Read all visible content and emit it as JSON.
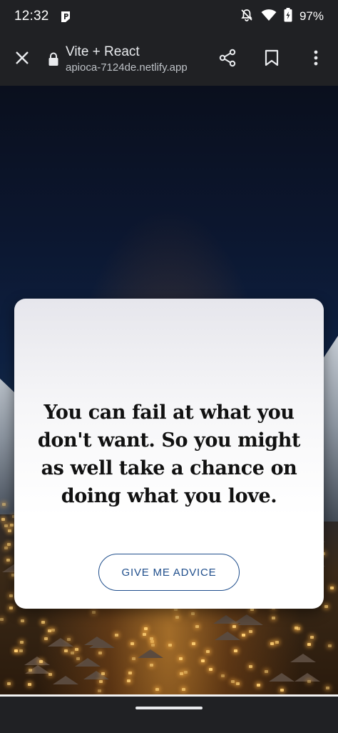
{
  "status_bar": {
    "time": "12:32",
    "battery": "97%",
    "icons": [
      "parking-p-icon",
      "bell-off-icon",
      "wifi-icon",
      "battery-charging-icon"
    ]
  },
  "browser": {
    "page_title": "Vite + React",
    "url": "apioca-7124de.netlify.app",
    "icons": [
      "close-icon",
      "lock-icon",
      "share-icon",
      "bookmark-icon",
      "more-vert-icon"
    ]
  },
  "card": {
    "quote": "You can fail at what you don't want. So you might as well take a chance on doing what you love.",
    "button_label": "GIVE ME ADVICE"
  },
  "colors": {
    "chrome_bg": "#202124",
    "button_accent": "#1f4e8c",
    "card_bg": "#ffffff"
  }
}
